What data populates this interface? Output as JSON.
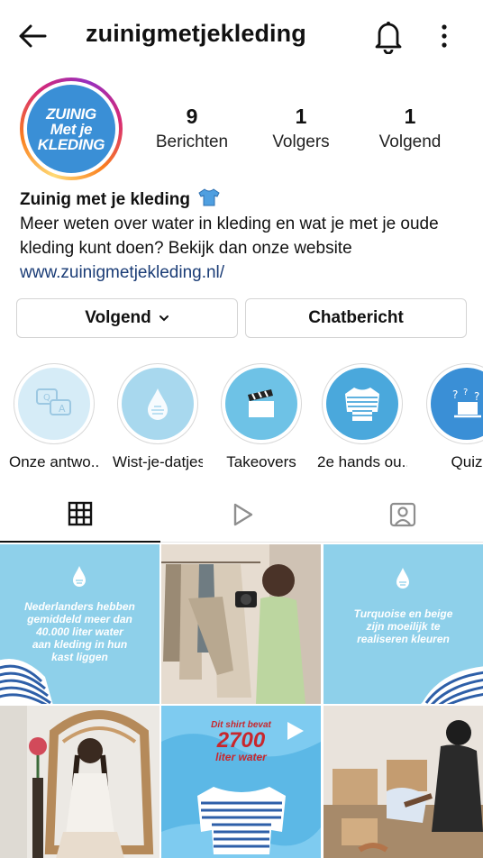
{
  "header": {
    "username": "zuinigmetjekleding",
    "icons": [
      "back-arrow-icon",
      "bell-icon",
      "more-vertical-icon"
    ]
  },
  "profile": {
    "avatar_text": [
      "ZUINIG",
      "Met je",
      "KLEDING"
    ],
    "stats": [
      {
        "number": "9",
        "label": "Berichten"
      },
      {
        "number": "1",
        "label": "Volgers"
      },
      {
        "number": "1",
        "label": "Volgend"
      }
    ],
    "display_name": "Zuinig met je kleding",
    "bio_line1": "Meer weten over water in kleding en wat je met je oude",
    "bio_line2": "kleding kunt doen? Bekijk dan onze website",
    "website": "www.zuinigmetjekleding.nl/"
  },
  "buttons": {
    "follow_label": "Volgend",
    "message_label": "Chatbericht"
  },
  "highlights": [
    {
      "label": "Onze antwo...",
      "icon": "chat-bubbles-icon",
      "color": "#d6ecf7"
    },
    {
      "label": "Wist-je-datjes",
      "icon": "water-drop-icon",
      "color": "#a8d8ee"
    },
    {
      "label": "Takeovers",
      "icon": "clapperboard-icon",
      "color": "#6ec2e6"
    },
    {
      "label": "2e hands ou...",
      "icon": "striped-sweater-icon",
      "color": "#4aa8dc"
    },
    {
      "label": "Quiz",
      "icon": "question-laptop-icon",
      "color": "#3a8fd6"
    }
  ],
  "tabs": [
    {
      "name": "grid",
      "icon": "grid-icon",
      "active": true
    },
    {
      "name": "reels",
      "icon": "play-icon",
      "active": false
    },
    {
      "name": "tagged",
      "icon": "tagged-person-icon",
      "active": false
    }
  ],
  "posts": {
    "tile1_text": [
      "Nederlanders hebben",
      "gemiddeld meer dan",
      "40.000 liter water",
      "aan kleding in hun",
      "kast liggen"
    ],
    "tile3_text": [
      "Turquoise en beige",
      "zijn moeilijk te",
      "realiseren kleuren"
    ],
    "tile5_text": [
      "Dit shirt bevat",
      "2700",
      "liter water"
    ]
  },
  "colors": {
    "accent_blue": "#3a8fd6",
    "tile_blue": "#8ed0ea",
    "link": "#1a3c76"
  }
}
